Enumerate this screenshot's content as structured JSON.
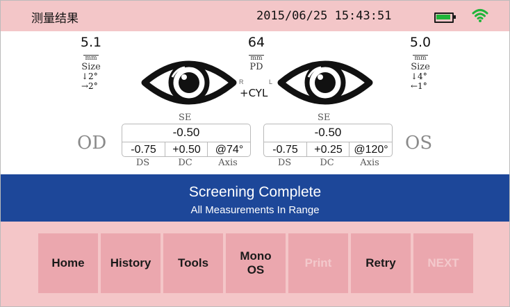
{
  "header": {
    "title": "测量结果",
    "datetime": "2015/06/25 15:43:51",
    "battery_color": "#1fb53a",
    "wifi_color": "#1fb53a",
    "icons": [
      "battery-icon",
      "wifi-icon"
    ]
  },
  "od": {
    "side_label": "OD",
    "size_value": "5.1",
    "size_unit": "mm",
    "size_caption": "Size",
    "prism_vertical": "↓2°",
    "prism_horizontal": "→2°",
    "se_title": "SE",
    "se": "-0.50",
    "ds": "-0.75",
    "dc": "+0.50",
    "axis": "@74°",
    "label_ds": "DS",
    "label_dc": "DC",
    "label_axis": "Axis"
  },
  "os": {
    "side_label": "OS",
    "size_value": "5.0",
    "size_unit": "mm",
    "size_caption": "Size",
    "prism_vertical": "↓4°",
    "prism_horizontal": "←1°",
    "se_title": "SE",
    "se": "-0.50",
    "ds": "-0.75",
    "dc": "+0.25",
    "axis": "@120°",
    "label_ds": "DS",
    "label_dc": "DC",
    "label_axis": "Axis"
  },
  "pd": {
    "value": "64",
    "unit": "mm",
    "caption": "PD"
  },
  "center": {
    "cyl_label": "+CYL",
    "r_marker": "R",
    "l_marker": "L"
  },
  "banner": {
    "line1": "Screening Complete",
    "line2": "All Measurements In Range",
    "color": "#1d4799"
  },
  "buttons": {
    "home": "Home",
    "history": "History",
    "tools": "Tools",
    "mono_line1": "Mono",
    "mono_line2": "OS",
    "print": "Print",
    "retry": "Retry",
    "next": "NEXT"
  }
}
